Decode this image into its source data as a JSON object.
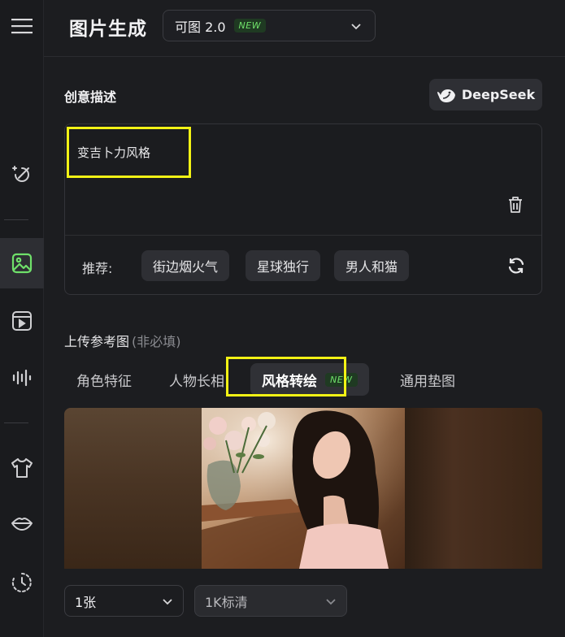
{
  "header": {
    "title": "图片生成",
    "model_name": "可图 2.0",
    "model_badge": "NEW"
  },
  "prompt_section": {
    "label": "创意描述",
    "deepseek_label": "DeepSeek",
    "prompt_text": "变吉卜力风格",
    "recommend_label": "推荐:",
    "chips": [
      "街边烟火气",
      "星球独行",
      "男人和猫"
    ]
  },
  "upload_section": {
    "label": "上传参考图",
    "hint": "(非必填)",
    "tabs": [
      {
        "label": "角色特征"
      },
      {
        "label": "人物长相"
      },
      {
        "label": "风格转绘",
        "badge": "NEW",
        "active": true
      },
      {
        "label": "通用垫图"
      }
    ]
  },
  "footer": {
    "count_value": "1张",
    "quality_value": "1K标清"
  },
  "colors": {
    "background": "#1c1d20",
    "accent_green": "#6fe06a",
    "highlight_yellow": "#f2f215"
  },
  "icons": {
    "sidebar": [
      "menu-icon",
      "magic-wand-icon",
      "image-icon",
      "video-icon",
      "audio-wave-icon",
      "shirt-icon",
      "lips-icon",
      "history-icon"
    ]
  }
}
